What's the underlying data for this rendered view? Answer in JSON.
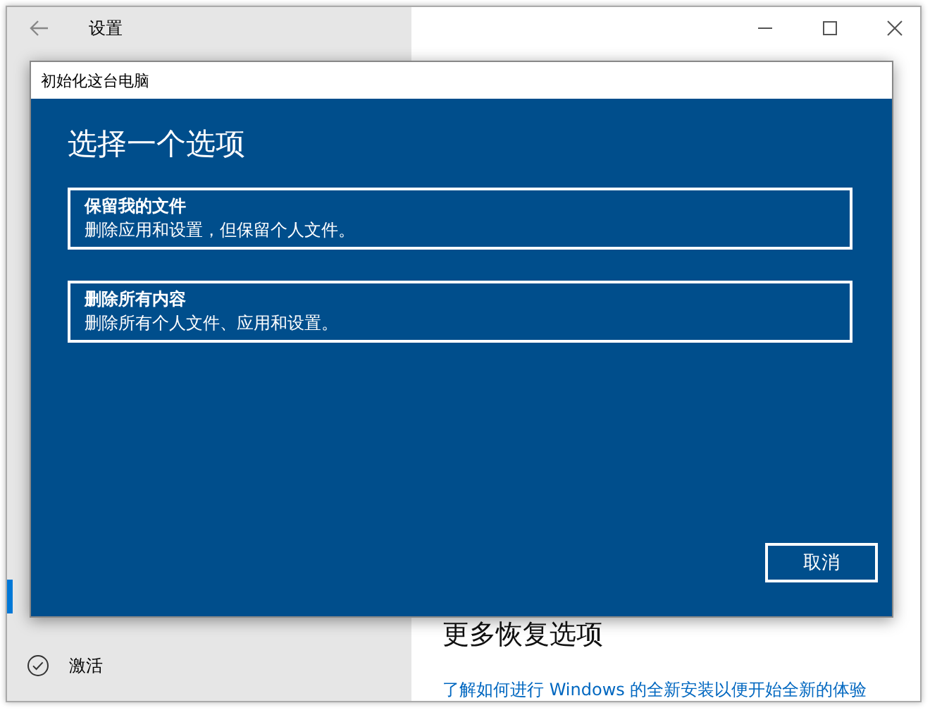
{
  "window": {
    "title": "设置"
  },
  "sidebar": {
    "items": [
      {
        "label": "激活",
        "selected": false
      }
    ]
  },
  "content": {
    "heading": "更多恢复选项",
    "link": "了解如何进行 Windows 的全新安装以便开始全新的体验"
  },
  "dialog": {
    "title": "初始化这台电脑",
    "heading": "选择一个选项",
    "options": [
      {
        "title": "保留我的文件",
        "description": "删除应用和设置，但保留个人文件。"
      },
      {
        "title": "删除所有内容",
        "description": "删除所有个人文件、应用和设置。"
      }
    ],
    "buttons": [
      "取消"
    ]
  }
}
